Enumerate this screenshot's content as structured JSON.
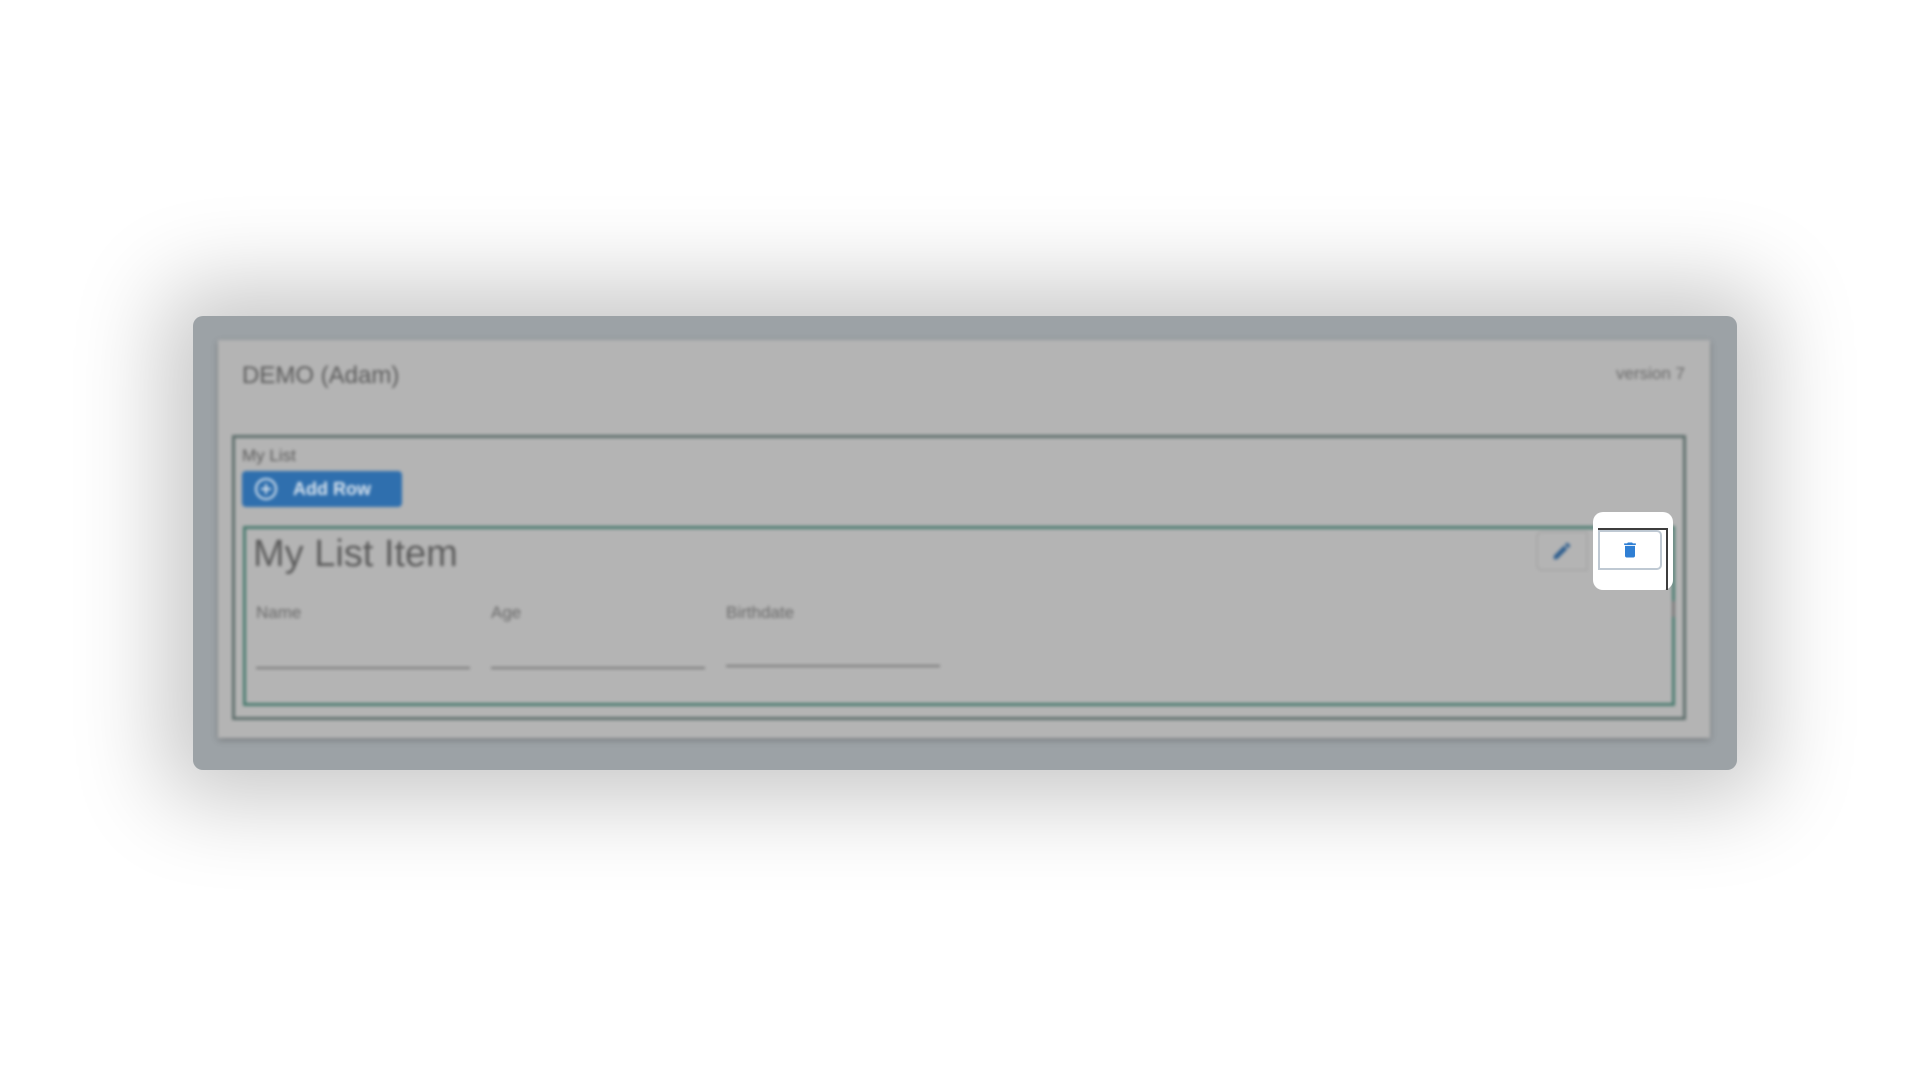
{
  "app": {
    "title": "DEMO (Adam)",
    "version": "version 7"
  },
  "list": {
    "label": "My List",
    "add_row_label": "Add Row"
  },
  "item": {
    "title": "My List Item",
    "fields": [
      {
        "label": "Name",
        "value": ""
      },
      {
        "label": "Age",
        "value": ""
      },
      {
        "label": "Birthdate",
        "value": ""
      }
    ]
  },
  "icons": {
    "add": "plus-circle-icon",
    "edit": "pencil-icon",
    "delete": "trash-icon"
  },
  "colors": {
    "primary": "#2f6fae",
    "delete_icon": "#2f7fd4",
    "overlay": "#9ca2a6"
  }
}
